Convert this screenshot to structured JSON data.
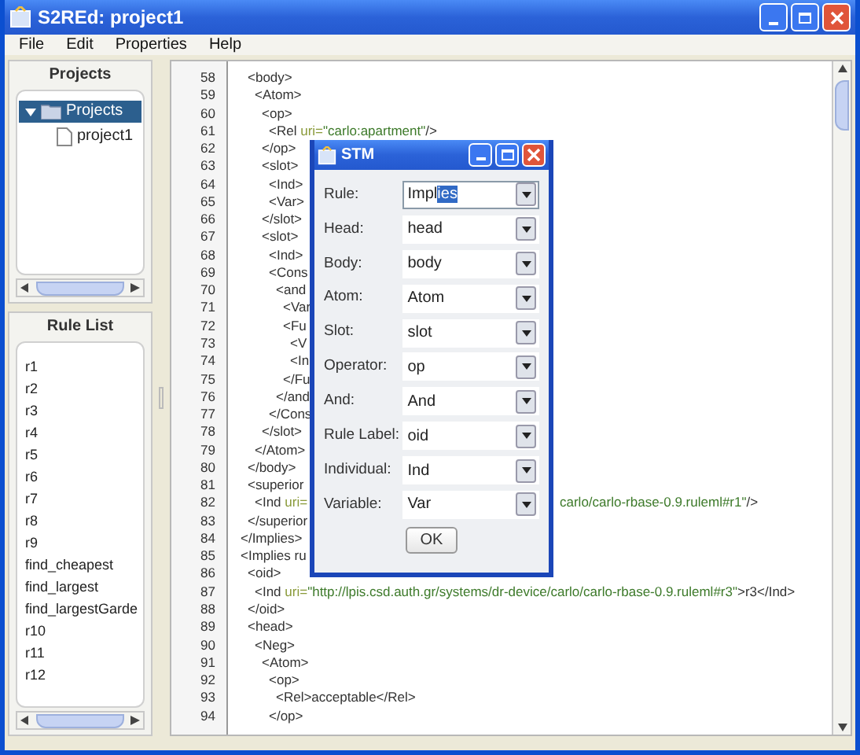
{
  "window": {
    "title": "S2REd: project1"
  },
  "menu": [
    "File",
    "Edit",
    "Properties",
    "Help"
  ],
  "projects": {
    "title": "Projects",
    "tree": [
      {
        "label": "Projects",
        "kind": "folder",
        "expanded": true,
        "selected": true,
        "children": [
          {
            "label": "project1",
            "kind": "file",
            "selected": false
          }
        ]
      }
    ]
  },
  "rule_list": {
    "title": "Rule List",
    "items": [
      "r1",
      "r2",
      "r3",
      "r4",
      "r5",
      "r6",
      "r7",
      "r8",
      "r9",
      "find_cheapest",
      "find_largest",
      "find_largestGarde",
      "r10",
      "r11",
      "r12"
    ]
  },
  "editor": {
    "lines": [
      {
        "number": "58",
        "text": "\t<body>"
      },
      {
        "number": "59",
        "text": "\t\t<Atom>"
      },
      {
        "number": "60",
        "text": "\t\t\t<op>"
      },
      {
        "number": "61",
        "parts": [
          {
            "kind": "tag",
            "text": "\t\t\t\t<Rel "
          },
          {
            "kind": "attr",
            "text": "uri="
          },
          {
            "kind": "value",
            "text": "\"carlo:apartment\""
          },
          {
            "kind": "tag",
            "text": "/>"
          }
        ]
      },
      {
        "number": "62",
        "text": "\t\t\t</op>"
      },
      {
        "number": "63",
        "text": "\t\t\t<slot>"
      },
      {
        "number": "64",
        "text": "\t\t\t\t<Ind>"
      },
      {
        "number": "65",
        "text": "\t\t\t\t<Var>"
      },
      {
        "number": "66",
        "text": "\t\t\t</slot>"
      },
      {
        "number": "67",
        "text": "\t\t\t<slot>"
      },
      {
        "number": "68",
        "text": "\t\t\t\t<Ind>"
      },
      {
        "number": "69",
        "text": "\t\t\t\t<Cons"
      },
      {
        "number": "70",
        "text": "\t\t\t\t\t<and"
      },
      {
        "number": "71",
        "text": "\t\t\t\t\t\t<Var"
      },
      {
        "number": "72",
        "text": "\t\t\t\t\t\t<Fu"
      },
      {
        "number": "73",
        "text": "\t\t\t\t\t\t\t<V"
      },
      {
        "number": "74",
        "text": "\t\t\t\t\t\t\t<In"
      },
      {
        "number": "75",
        "text": "\t\t\t\t\t\t</Fu"
      },
      {
        "number": "76",
        "text": "\t\t\t\t\t</and"
      },
      {
        "number": "77",
        "text": "\t\t\t\t</Cons"
      },
      {
        "number": "78",
        "text": "\t\t\t</slot>"
      },
      {
        "number": "79",
        "text": "\t\t</Atom>"
      },
      {
        "number": "80",
        "text": "\t</body>"
      },
      {
        "number": "81",
        "text": "\t<superior"
      },
      {
        "number": "82",
        "parts": [
          {
            "kind": "tag",
            "text": "\t\t<Ind "
          },
          {
            "kind": "attr",
            "text": "uri="
          }
        ],
        "tail": [
          {
            "kind": "value",
            "text": "carlo/carlo-rbase-0.9.ruleml#r1\""
          },
          {
            "kind": "tag",
            "text": "/>"
          }
        ]
      },
      {
        "number": "83",
        "text": "\t</superior"
      },
      {
        "number": "84",
        "text": "</Implies>"
      },
      {
        "number": "85",
        "text": "<Implies ru"
      },
      {
        "number": "86",
        "text": "\t<oid>"
      },
      {
        "number": "87",
        "parts": [
          {
            "kind": "tag",
            "text": "\t\t<Ind "
          },
          {
            "kind": "attr",
            "text": "uri="
          },
          {
            "kind": "value",
            "text": "\"http://lpis.csd.auth.gr/systems/dr-device/carlo/carlo-rbase-0.9.ruleml#r3\""
          },
          {
            "kind": "tag",
            "text": ">r3</Ind>"
          }
        ]
      },
      {
        "number": "88",
        "text": "\t</oid>"
      },
      {
        "number": "89",
        "text": "\t<head>"
      },
      {
        "number": "90",
        "text": "\t\t<Neg>"
      },
      {
        "number": "91",
        "text": "\t\t\t<Atom>"
      },
      {
        "number": "92",
        "text": "\t\t\t\t<op>"
      },
      {
        "number": "93",
        "text": "\t\t\t\t\t<Rel>acceptable</Rel>"
      },
      {
        "number": "94",
        "text": "\t\t\t\t</op>"
      }
    ]
  },
  "dialog": {
    "title": "STM",
    "fields": [
      {
        "label": "Rule:",
        "value": "Impl",
        "highlighted": "ies",
        "editable": true
      },
      {
        "label": "Head:",
        "value": "head",
        "editable": false
      },
      {
        "label": "Body:",
        "value": "body",
        "editable": false
      },
      {
        "label": "Atom:",
        "value": "Atom",
        "editable": false
      },
      {
        "label": "Slot:",
        "value": "slot",
        "editable": false
      },
      {
        "label": "Operator:",
        "value": "op",
        "editable": false
      },
      {
        "label": "And:",
        "value": "And",
        "editable": false
      },
      {
        "label": "Rule Label:",
        "value": "oid",
        "editable": false
      },
      {
        "label": "Individual:",
        "value": "Ind",
        "editable": false
      },
      {
        "label": "Variable:",
        "value": "Var",
        "editable": false
      }
    ],
    "button": "OK"
  }
}
